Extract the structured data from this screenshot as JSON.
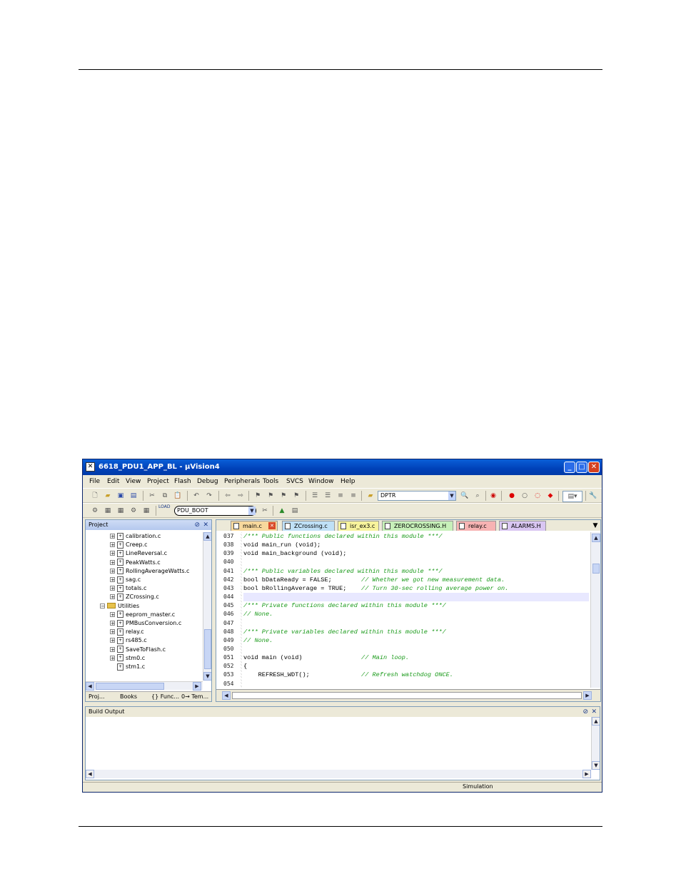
{
  "window": {
    "title": "6618_PDU1_APP_BL - µVision4",
    "app_icon": "uvision-icon"
  },
  "menu": [
    "File",
    "Edit",
    "View",
    "Project",
    "Flash",
    "Debug",
    "Peripherals",
    "Tools",
    "SVCS",
    "Window",
    "Help"
  ],
  "toolbar": {
    "find_combo_value": "DPTR",
    "target_combo_value": "PDU_BOOT",
    "load_label": "LOAD"
  },
  "project_panel": {
    "title": "Project",
    "items": [
      {
        "label": "calibration.c",
        "level": 2
      },
      {
        "label": "Creep.c",
        "level": 2
      },
      {
        "label": "LineReversal.c",
        "level": 2
      },
      {
        "label": "PeakWatts.c",
        "level": 2
      },
      {
        "label": "RollingAverageWatts.c",
        "level": 2
      },
      {
        "label": "sag.c",
        "level": 2
      },
      {
        "label": "totals.c",
        "level": 2
      },
      {
        "label": "ZCrossing.c",
        "level": 2
      },
      {
        "label": "Utilities",
        "level": 1
      },
      {
        "label": "eeprom_master.c",
        "level": 2
      },
      {
        "label": "PMBusConversion.c",
        "level": 2
      },
      {
        "label": "relay.c",
        "level": 2
      },
      {
        "label": "rs485.c",
        "level": 2
      },
      {
        "label": "SaveToFlash.c",
        "level": 2
      },
      {
        "label": "stm0.c",
        "level": 2
      },
      {
        "label": "stm1.c",
        "level": 2
      }
    ],
    "tabs": [
      "Proj...",
      "Books",
      "{} Func...",
      "0→ Tem..."
    ]
  },
  "editor": {
    "tabs": [
      {
        "label": "main.c",
        "color": "#f7d89c",
        "active": true
      },
      {
        "label": "ZCrossing.c",
        "color": "#bfe0f7"
      },
      {
        "label": "isr_ex3.c",
        "color": "#f7f39c"
      },
      {
        "label": "ZEROCROSSING.H",
        "color": "#c7f0b9"
      },
      {
        "label": "relay.c",
        "color": "#f7b3b3"
      },
      {
        "label": "ALARMS.H",
        "color": "#d9c6f2"
      }
    ],
    "lines": [
      {
        "num": "037",
        "code": "",
        "comment": "/*** Public functions declared within this module ***/"
      },
      {
        "num": "038",
        "code": "void main_run (void);",
        "comment": ""
      },
      {
        "num": "039",
        "code": "void main_background (void);",
        "comment": ""
      },
      {
        "num": "040",
        "code": "",
        "comment": ""
      },
      {
        "num": "041",
        "code": "",
        "comment": "/*** Public variables declared within this module ***/"
      },
      {
        "num": "042",
        "code": "bool bDataReady = FALSE;        ",
        "comment": "// Whether we got new measurement data."
      },
      {
        "num": "043",
        "code": "bool bRollingAverage = TRUE;    ",
        "comment": "// Turn 30-sec rolling average power on."
      },
      {
        "num": "044",
        "code": "",
        "comment": ""
      },
      {
        "num": "045",
        "code": "",
        "comment": "/*** Private functions declared within this module ***/"
      },
      {
        "num": "046",
        "code": "",
        "comment": "// None."
      },
      {
        "num": "047",
        "code": "",
        "comment": ""
      },
      {
        "num": "048",
        "code": "",
        "comment": "/*** Private variables declared within this module ***/"
      },
      {
        "num": "049",
        "code": "",
        "comment": "// None."
      },
      {
        "num": "050",
        "code": "",
        "comment": ""
      },
      {
        "num": "051",
        "code": "void main (void)                ",
        "comment": "// Main loop."
      },
      {
        "num": "052",
        "code": "{",
        "comment": ""
      },
      {
        "num": "053",
        "code": "    REFRESH_WDT();              ",
        "comment": "// Refresh watchdog ONCE."
      },
      {
        "num": "054",
        "code": "",
        "comment": ""
      }
    ]
  },
  "build_panel": {
    "title": "Build Output"
  },
  "status": {
    "mode": "Simulation"
  }
}
